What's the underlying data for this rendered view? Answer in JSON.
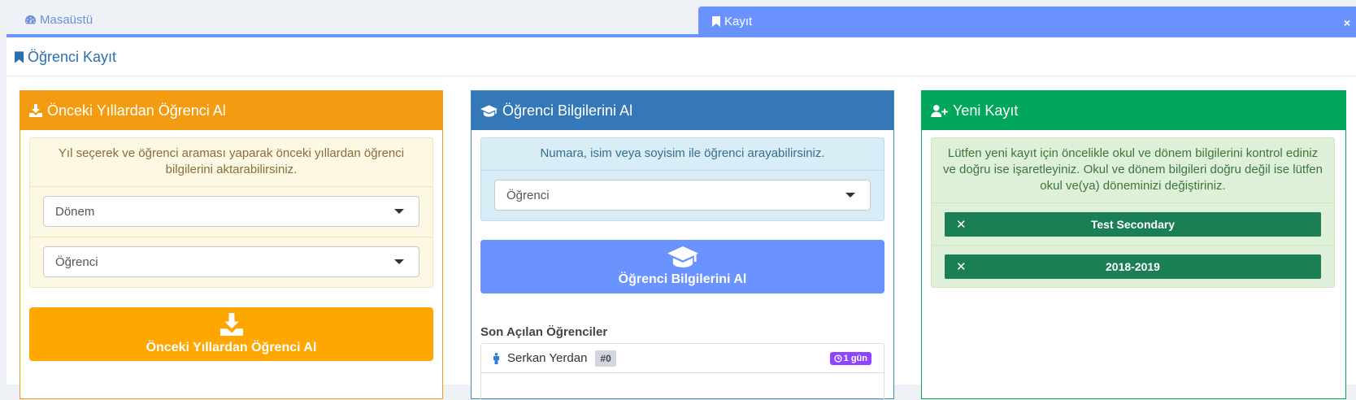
{
  "tabs": {
    "home_label": "Masaüstü",
    "active_label": "Kayıt",
    "close_symbol": "×"
  },
  "page": {
    "title": "Öğrenci Kayıt"
  },
  "panel_previous": {
    "title": "Önceki Yıllardan Öğrenci Al",
    "message": "Yıl seçerek ve öğrenci araması yaparak önceki yıllardan öğrenci bilgilerini aktarabilirsiniz.",
    "term_select": "Dönem",
    "student_select": "Öğrenci",
    "button_label": "Önceki Yıllardan Öğrenci Al",
    "color": "#f39c12"
  },
  "panel_info": {
    "title": "Öğrenci Bilgilerini Al",
    "message": "Numara, isim veya soyisim ile öğrenci arayabilirsiniz.",
    "student_select": "Öğrenci",
    "button_label": "Öğrenci Bilgilerini Al",
    "recent_title": "Son Açılan Öğrenciler",
    "recent": [
      {
        "name": "Serkan Yerdan",
        "number": "#0",
        "time": "1 gün"
      }
    ],
    "color": "#3478b8"
  },
  "panel_new": {
    "title": "Yeni Kayıt",
    "message": "Lütfen yeni kayıt için öncelikle okul ve dönem bilgilerini kontrol ediniz ve doğru ise işaretleyiniz. Okul ve dönem bilgileri doğru değil ise lütfen okul ve(ya) döneminizi değiştiriniz.",
    "school": "Test Secondary",
    "term": "2018-2019",
    "color": "#00a65a"
  },
  "icons": [
    "dashboard-icon",
    "bookmark-icon",
    "download-icon",
    "graduation-cap-icon",
    "user-plus-icon",
    "close-icon",
    "caret-down-icon",
    "male-icon",
    "clock-icon"
  ]
}
